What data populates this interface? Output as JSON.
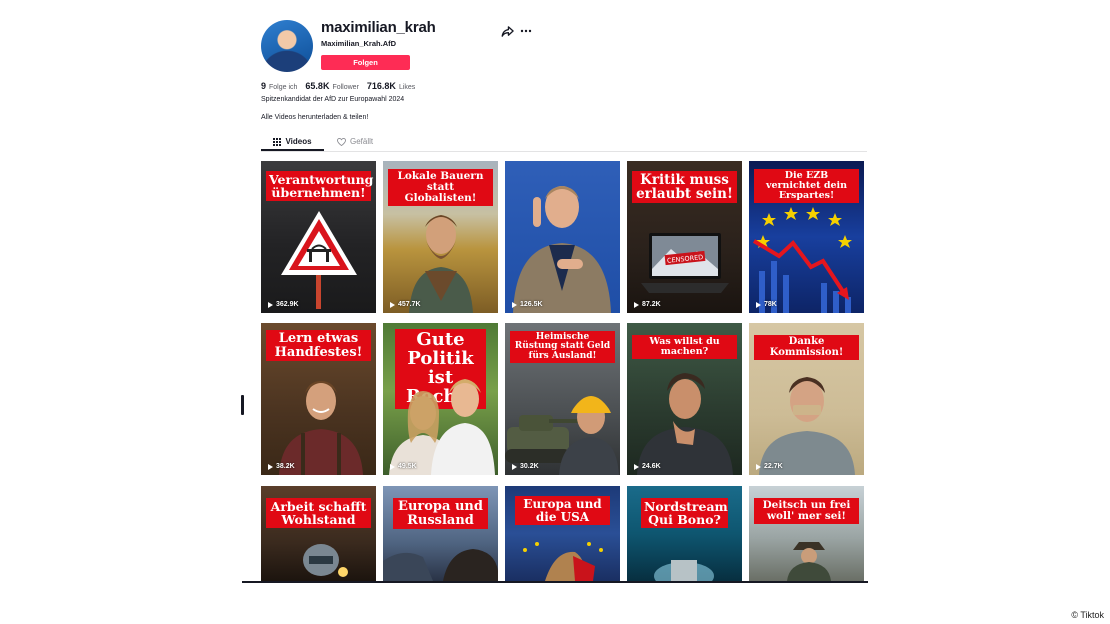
{
  "profile": {
    "username": "maximilian_krah",
    "nickname": "Maximilian_Krah.AfD",
    "follow_label": "Folgen",
    "following_count": "9",
    "following_label": "Folge ich",
    "followers_count": "65.8K",
    "followers_label": "Follower",
    "likes_count": "716.8K",
    "likes_label": "Likes",
    "bio_line1": "Spitzenkandidat der AfD zur Europawahl 2024",
    "bio_line2": "Alle Videos herunterladen & teilen!"
  },
  "tabs": {
    "videos": "Videos",
    "liked": "Gefällt"
  },
  "videos": [
    {
      "title": "Verantwortung übernehmen!",
      "views": "362.9K"
    },
    {
      "title": "Lokale Bauern statt Globalisten!",
      "views": "457.7K"
    },
    {
      "title": "",
      "views": "126.5K"
    },
    {
      "title": "Kritik muss erlaubt sein!",
      "views": "87.2K"
    },
    {
      "title": "Die EZB vernichtet dein Erspartes!",
      "views": "78K"
    },
    {
      "title": "Lern etwas Handfestes!",
      "views": "38.2K"
    },
    {
      "title": "Gute Politik ist Rechts",
      "views": "49.5K"
    },
    {
      "title": "Heimische Rüstung statt Geld fürs Ausland!",
      "views": "30.2K"
    },
    {
      "title": "Was willst du machen?",
      "views": "24.6K"
    },
    {
      "title": "Danke Kommission!",
      "views": "22.7K"
    },
    {
      "title": "Arbeit schafft Wohlstand",
      "views": ""
    },
    {
      "title": "Europa und Russland",
      "views": ""
    },
    {
      "title": "Europa und die USA",
      "views": ""
    },
    {
      "title": "Nordstream Qui Bono?",
      "views": ""
    },
    {
      "title": "Deitsch un frei woll' mer sei!",
      "views": ""
    }
  ],
  "thumb_misc": {
    "censored": "CENSORED"
  },
  "credit": "© Tiktok",
  "colors": {
    "accent": "#fe2c55",
    "banner_red": "#e00914"
  }
}
